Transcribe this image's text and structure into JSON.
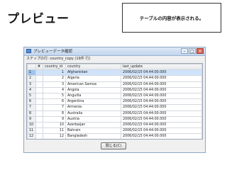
{
  "slide_title": "プレビュー",
  "callout_text": "テーブルの内容が表示される。",
  "window": {
    "title": "プレビューデータ確認",
    "step_line": "ステップの行: country_copy (19件 行)",
    "close_button": "閉じる(C)"
  },
  "table": {
    "headers": [
      "",
      "#",
      "country_id",
      "country",
      "last_update"
    ],
    "rows": [
      [
        "1",
        "1",
        "Afghanistan",
        "2006/02/15 04:44:00.000"
      ],
      [
        "2",
        "2",
        "Algeria",
        "2006/02/15 04:44:00.000"
      ],
      [
        "3",
        "3",
        "American Samoa",
        "2006/02/15 04:44:00.000"
      ],
      [
        "4",
        "4",
        "Angola",
        "2006/02/15 04:44:00.000"
      ],
      [
        "5",
        "5",
        "Anguilla",
        "2006/02/15 04:44:00.000"
      ],
      [
        "6",
        "6",
        "Argentina",
        "2006/02/15 04:44:00.000"
      ],
      [
        "7",
        "7",
        "Armenia",
        "2006/02/15 04:44:00.000"
      ],
      [
        "8",
        "8",
        "Australia",
        "2006/02/15 04:44:00.000"
      ],
      [
        "9",
        "9",
        "Austria",
        "2006/02/15 04:44:00.000"
      ],
      [
        "10",
        "10",
        "Azerbaijan",
        "2006/02/15 04:44:00.000"
      ],
      [
        "11",
        "11",
        "Bahrain",
        "2006/02/15 04:44:00.000"
      ],
      [
        "12",
        "12",
        "Bangladesh",
        "2006/02/15 04:44:00.000"
      ]
    ],
    "empty_rows": 2
  }
}
